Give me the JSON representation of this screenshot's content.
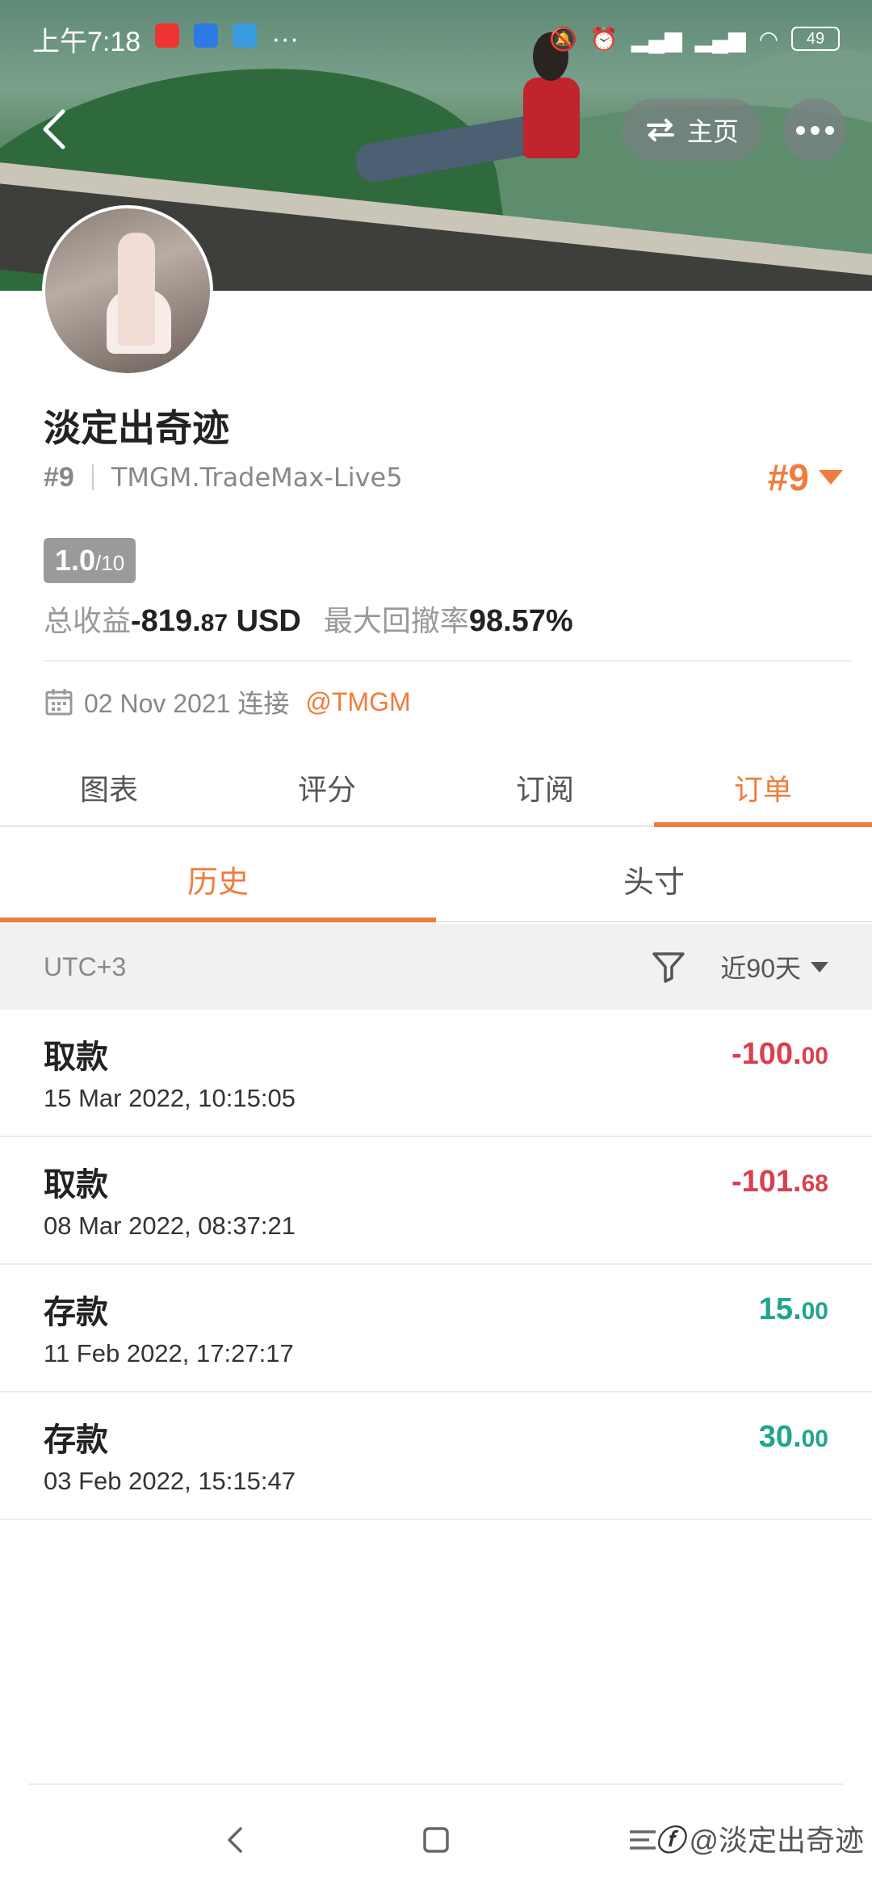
{
  "status_bar": {
    "time": "上午7:18",
    "battery": "49"
  },
  "header": {
    "home_label": "主页"
  },
  "profile": {
    "name": "淡定出奇迹",
    "rank": "#9",
    "server": "TMGM.TradeMax-Live5",
    "rank_right": "#9",
    "score_main": "1.0",
    "score_total": "/10",
    "profit_label": "总收益",
    "profit_int": "-819.",
    "profit_dec": "87",
    "profit_unit": " USD",
    "drawdown_label": "最大回撤率",
    "drawdown_value": "98.57%",
    "joined_text": "02 Nov 2021 连接",
    "broker": "@TMGM"
  },
  "tabs": [
    "图表",
    "评分",
    "订阅",
    "订单"
  ],
  "active_tab_index": 3,
  "subtabs": [
    "历史",
    "头寸"
  ],
  "active_subtab_index": 0,
  "filter": {
    "timezone": "UTC+3",
    "range": "近90天"
  },
  "transactions": [
    {
      "type": "取款",
      "date": "15 Mar 2022, 10:15:05",
      "amount_int": "-100.",
      "amount_dec": "00",
      "sign": "neg"
    },
    {
      "type": "取款",
      "date": "08 Mar 2022, 08:37:21",
      "amount_int": "-101.",
      "amount_dec": "68",
      "sign": "neg"
    },
    {
      "type": "存款",
      "date": "11 Feb 2022, 17:27:17",
      "amount_int": "15.",
      "amount_dec": "00",
      "sign": "pos"
    },
    {
      "type": "存款",
      "date": "03 Feb 2022, 15:15:47",
      "amount_int": "30.",
      "amount_dec": "00",
      "sign": "pos"
    }
  ],
  "watermark": "@淡定出奇迹",
  "colors": {
    "accent": "#f07c3c",
    "negative": "#d9404f",
    "positive": "#1fa58c"
  }
}
